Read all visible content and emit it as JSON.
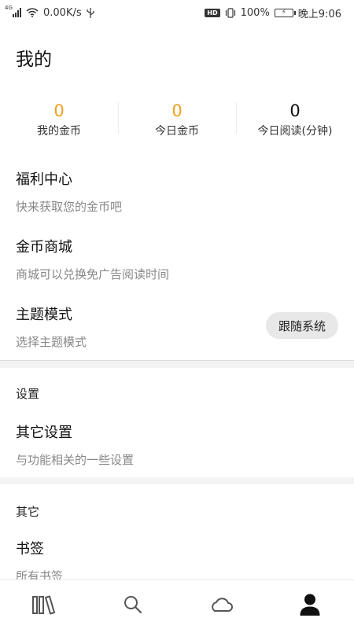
{
  "status_bar": {
    "network_type": "4G",
    "speed": "0.00K/s",
    "hd_label": "HD",
    "battery": "100%",
    "time": "晚上9:06"
  },
  "page": {
    "title": "我的"
  },
  "stats": [
    {
      "value": "0",
      "label": "我的金币",
      "color": "#f0a020"
    },
    {
      "value": "0",
      "label": "今日金币",
      "color": "#f0a020"
    },
    {
      "value": "0",
      "label": "今日阅读(分钟)",
      "color": "#111111"
    }
  ],
  "welfare": {
    "title": "福利中心",
    "subtitle": "快来获取您的金币吧"
  },
  "store": {
    "title": "金币商城",
    "subtitle": "商城可以兑换免广告阅读时间"
  },
  "theme": {
    "title": "主题模式",
    "subtitle": "选择主题模式",
    "value": "跟随系统"
  },
  "settings_section": {
    "heading": "设置",
    "item": {
      "title": "其它设置",
      "subtitle": "与功能相关的一些设置"
    }
  },
  "other_section": {
    "heading": "其它",
    "item": {
      "title": "书签",
      "subtitle": "所有书签"
    }
  },
  "bottom_nav": [
    {
      "icon": "bookshelf-icon",
      "active": false
    },
    {
      "icon": "search-icon",
      "active": false
    },
    {
      "icon": "cloud-icon",
      "active": false
    },
    {
      "icon": "profile-icon",
      "active": true
    }
  ]
}
